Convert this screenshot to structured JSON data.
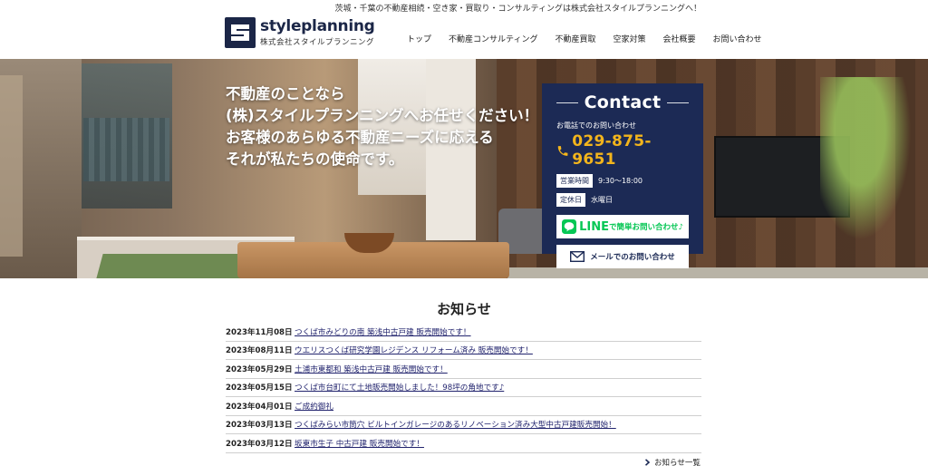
{
  "header": {
    "tagline": "茨城・千葉の不動産相続・空き家・買取り・コンサルティングは株式会社スタイルプランニングへ！",
    "logo_name": "styleplanning",
    "logo_sub": "株式会社スタイルプランニング",
    "nav": [
      "トップ",
      "不動産コンサルティング",
      "不動産買取",
      "空家対策",
      "会社概要",
      "お問い合わせ"
    ]
  },
  "hero": {
    "lines": [
      "不動産のことなら",
      "(株)スタイルプランニングへお任せください！",
      "お客様のあらゆる不動産ニーズに応える",
      "それが私たちの使命です。"
    ]
  },
  "contact": {
    "title": "Contact",
    "phone_label": "お電話でのお問い合わせ",
    "phone": "029-875-9651",
    "hours_tag": "営業時間",
    "hours_value": "9:30～18:00",
    "holiday_tag": "定休日",
    "holiday_value": "水曜日",
    "line_word": "LINE",
    "line_rest": "で簡単お問い合わせ♪",
    "mail_label": "メールでのお問い合わせ",
    "colors": {
      "panel": "#1c2a55",
      "phone": "#f3b51c",
      "line": "#06c755"
    }
  },
  "news": {
    "title": "お知らせ",
    "items": [
      {
        "date": "2023年11月08日",
        "text": "つくば市みどりの南 築浅中古戸建 販売開始です！"
      },
      {
        "date": "2023年08月11日",
        "text": "ウエリスつくば研究学園レジデンス リフォーム済み 販売開始です！"
      },
      {
        "date": "2023年05月29日",
        "text": "土浦市東都和 築浅中古戸建 販売開始です！"
      },
      {
        "date": "2023年05月15日",
        "text": "つくば市台町にて土地販売開始しました！98坪の角地です♪"
      },
      {
        "date": "2023年04月01日",
        "text": "ご成約御礼"
      },
      {
        "date": "2023年03月13日",
        "text": "つくばみらい市筒穴 ビルトインガレージのあるリノベーション済み大型中古戸建販売開始！"
      },
      {
        "date": "2023年03月12日",
        "text": "坂東市生子 中古戸建 販売開始です！"
      }
    ],
    "more": "お知らせ一覧"
  }
}
